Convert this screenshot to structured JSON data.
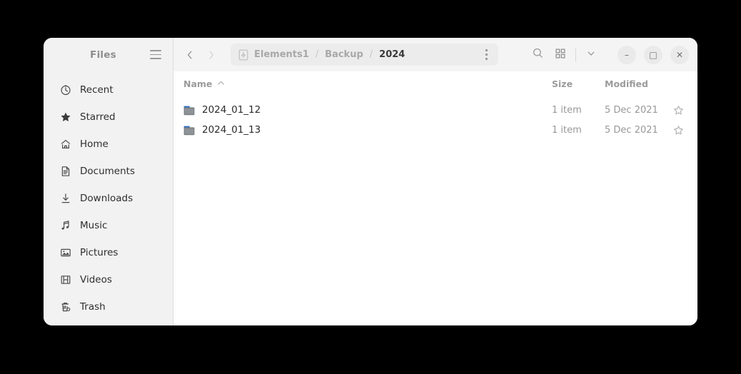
{
  "window": {
    "sidebar": {
      "title": "Files",
      "menu_icon": "hamburger-menu-icon",
      "items": [
        {
          "label": "Recent",
          "icon": "clock-icon"
        },
        {
          "label": "Starred",
          "icon": "star-filled-icon"
        },
        {
          "label": "Home",
          "icon": "home-icon"
        },
        {
          "label": "Documents",
          "icon": "document-icon"
        },
        {
          "label": "Downloads",
          "icon": "download-arrow-icon"
        },
        {
          "label": "Music",
          "icon": "music-note-icon"
        },
        {
          "label": "Pictures",
          "icon": "picture-icon"
        },
        {
          "label": "Videos",
          "icon": "film-strip-icon"
        },
        {
          "label": "Trash",
          "icon": "trash-icon"
        }
      ]
    },
    "headerbar": {
      "back_icon": "chevron-left-icon",
      "forward_icon": "chevron-right-icon",
      "drive_icon": "usb-drive-icon",
      "breadcrumbs": [
        {
          "label": "Elements1",
          "current": false
        },
        {
          "label": "Backup",
          "current": false
        },
        {
          "label": "2024",
          "current": true
        }
      ],
      "separator": "/",
      "kebab_icon": "more-options-vertical-icon",
      "search_icon": "search-icon",
      "view_grid_icon": "grid-view-icon",
      "view_dropdown_icon": "chevron-down-icon",
      "minimize_label": "–",
      "maximize_label": "□",
      "close_label": "✕"
    },
    "file_list": {
      "columns": [
        {
          "key": "name",
          "label": "Name",
          "sort_icon": "sort-ascending-icon"
        },
        {
          "key": "size",
          "label": "Size"
        },
        {
          "key": "modified",
          "label": "Modified"
        }
      ],
      "rows": [
        {
          "icon": "folder-icon",
          "name": "2024_01_12",
          "size": "1 item",
          "modified": "5 Dec 2021",
          "star_icon": "star-outline-icon"
        },
        {
          "icon": "folder-icon",
          "name": "2024_01_13",
          "size": "1 item",
          "modified": "5 Dec 2021",
          "star_icon": "star-outline-icon"
        }
      ]
    }
  },
  "colors": {
    "desktop_background": "#000000",
    "window_background": "#ffffff",
    "sidebar_background": "#f2f2f2",
    "headerbar_background": "#f4f4f4",
    "pathbar_background": "#ececec",
    "folder_body": "#7b8085",
    "folder_tab": "#2a6fc9",
    "text_primary": "#2b2b2b",
    "text_muted": "#989898"
  }
}
